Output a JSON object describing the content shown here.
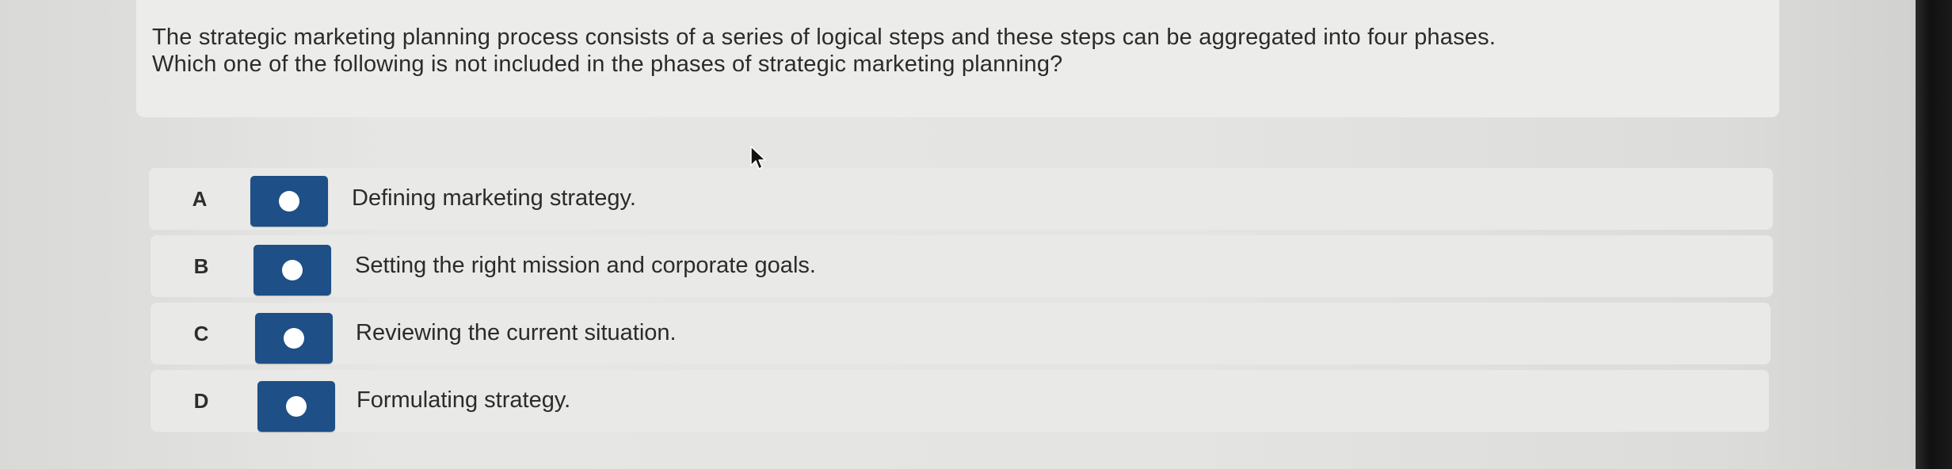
{
  "question": {
    "line1": "The strategic marketing planning process consists of a series of logical steps and these steps can be aggregated into four phases.",
    "line2": "Which one of the following is not included in the phases of strategic marketing planning?"
  },
  "options": [
    {
      "letter": "A",
      "text": "Defining marketing strategy."
    },
    {
      "letter": "B",
      "text": "Setting the right mission and corporate goals."
    },
    {
      "letter": "C",
      "text": "Reviewing the current situation."
    },
    {
      "letter": "D",
      "text": "Formulating strategy."
    }
  ],
  "colors": {
    "radio_button": "#1e4f87",
    "radio_dot": "#ffffff",
    "option_background": "#e9e9e7",
    "text": "#2b2b2b"
  },
  "icons": {
    "pointer": "mouse-pointer-icon"
  }
}
